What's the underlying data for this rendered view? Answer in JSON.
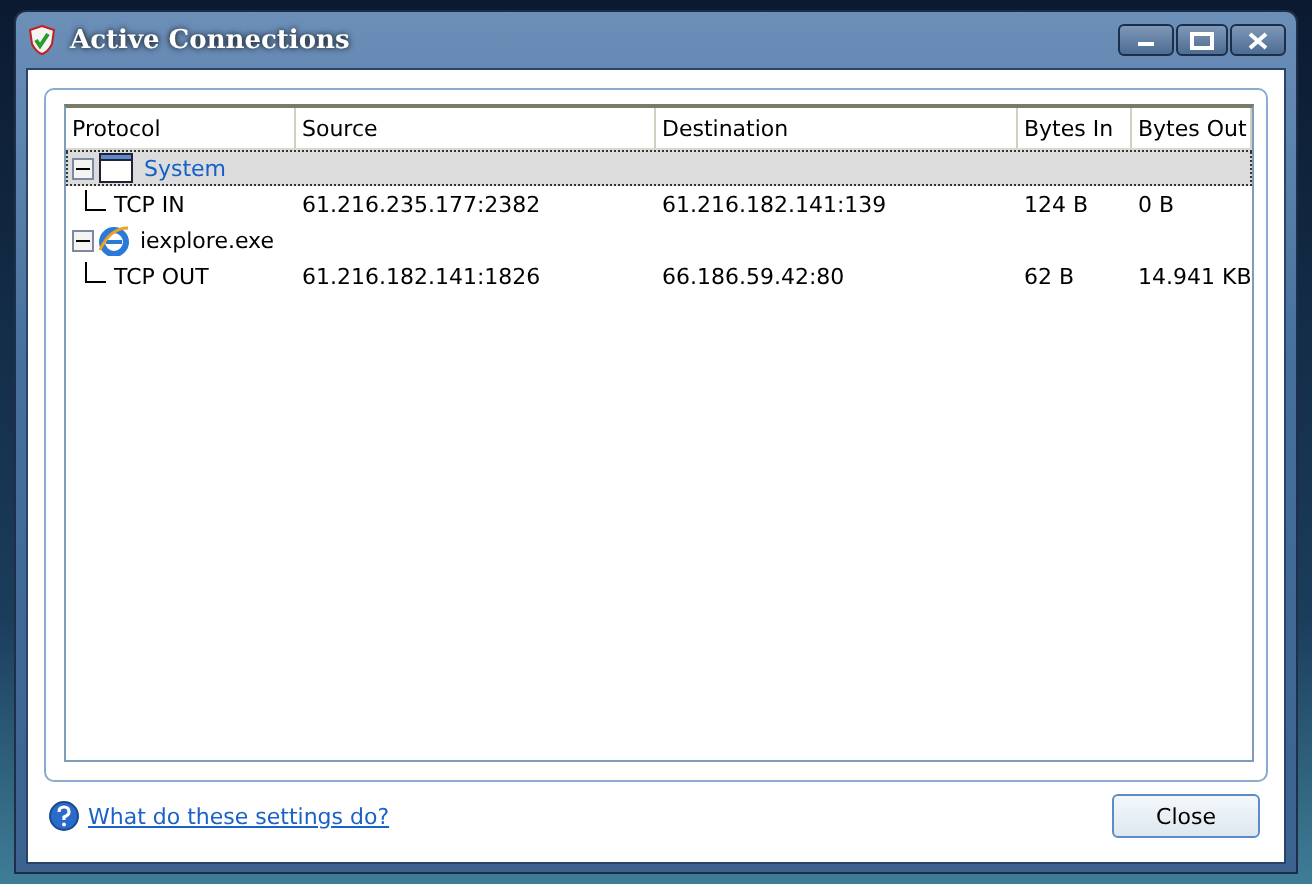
{
  "window": {
    "title": "Active Connections"
  },
  "table": {
    "columns": [
      "Protocol",
      "Source",
      "Destination",
      "Bytes In",
      "Bytes Out"
    ],
    "groups": [
      {
        "name": "System",
        "kind": "window",
        "selected": true,
        "expanded": true,
        "children": [
          {
            "protocol": "TCP IN",
            "source": "61.216.235.177:2382",
            "destination": "61.216.182.141:139",
            "bytes_in": "124 B",
            "bytes_out": "0 B"
          }
        ]
      },
      {
        "name": "iexplore.exe",
        "kind": "browser",
        "selected": false,
        "expanded": true,
        "children": [
          {
            "protocol": "TCP OUT",
            "source": "61.216.182.141:1826",
            "destination": "66.186.59.42:80",
            "bytes_in": "62 B",
            "bytes_out": "14.941 KB"
          }
        ]
      }
    ]
  },
  "help_link": "What do these settings do?",
  "buttons": [
    "Close"
  ]
}
